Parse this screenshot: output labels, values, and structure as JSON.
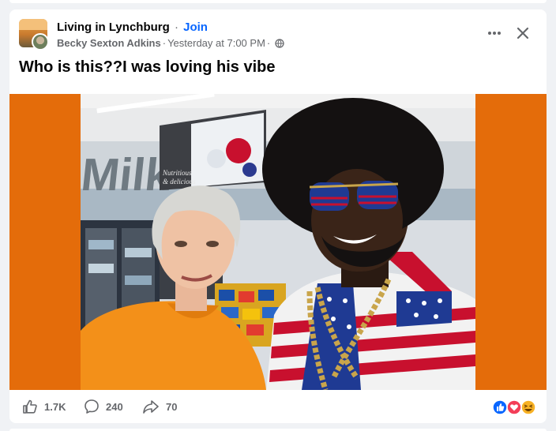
{
  "post": {
    "group_name": "Living in Lynchburg",
    "separator": "·",
    "join_label": "Join",
    "author": "Becky Sexton Adkins",
    "time": "Yesterday at 7:00 PM",
    "privacy_icon": "globe-icon",
    "text": "Who is this??I was loving his vibe"
  },
  "media": {
    "background_color": "#e46c0a",
    "sign_text": "Milk",
    "poster_caption_1": "Nutritious",
    "poster_caption_2": "& delicious"
  },
  "footer": {
    "like_count": "1.7K",
    "comment_count": "240",
    "share_count": "70",
    "reaction_icons": [
      "like-reaction-icon",
      "love-reaction-icon",
      "haha-reaction-icon"
    ]
  },
  "colors": {
    "link_blue": "#0866ff",
    "secondary_text": "#65676b",
    "like_blue": "#0866ff",
    "love_red": "#f33e58",
    "haha_yellow": "#f7b125"
  }
}
